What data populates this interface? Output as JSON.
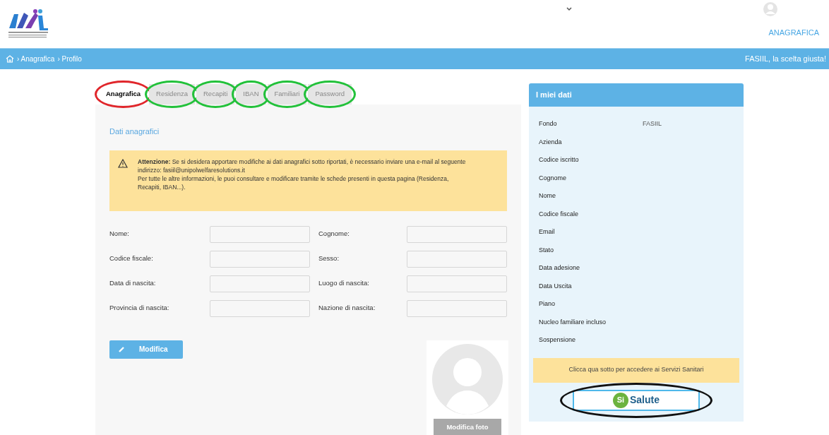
{
  "header": {
    "nav_link": "ANAGRAFICA"
  },
  "breadcrumb": {
    "items": [
      "› Anagrafica",
      "› Profilo"
    ],
    "slogan": "FASIIL, la scelta giusta!"
  },
  "tabs": [
    {
      "label": "Anagrafica",
      "selected": true,
      "color": "#e0262b"
    },
    {
      "label": "Residenza",
      "selected": false,
      "color": "#22c13a"
    },
    {
      "label": "Recapiti",
      "selected": false,
      "color": "#22c13a"
    },
    {
      "label": "IBAN",
      "selected": false,
      "color": "#22c13a"
    },
    {
      "label": "Familiari",
      "selected": false,
      "color": "#22c13a"
    },
    {
      "label": "Password",
      "selected": false,
      "color": "#22c13a"
    }
  ],
  "section_title": "Dati anagrafici",
  "warning": {
    "text": "**Attenzione:** Se si desidera apportare modifiche ai dati anagrafici sotto riportati, è necessario inviare una e-mail al seguente indirizzo: fasiil@unipolwelfaresolutions.it",
    "text2": "Per tutte le altre informazioni, le puoi consultare e modificare tramite le schede presenti in questa pagina (Residenza, Recapiti, IBAN...)."
  },
  "fields": [
    {
      "label": "Nome:"
    },
    {
      "label": "Cognome:"
    },
    {
      "label": "Codice fiscale:"
    },
    {
      "label": "Sesso:"
    },
    {
      "label": "Data di nascita:"
    },
    {
      "label": "Luogo di nascita:"
    },
    {
      "label": "Provincia di nascita:"
    },
    {
      "label": "Nazione di nascita:"
    }
  ],
  "edit_button": "Modifica",
  "photo_button": "Modifica foto",
  "my_data": {
    "title": "I miei dati",
    "rows": [
      {
        "label": "Fondo",
        "value": "FASIIL"
      },
      {
        "label": "Azienda"
      },
      {
        "label": "Codice iscritto"
      },
      {
        "label": "Cognome"
      },
      {
        "label": "Nome"
      },
      {
        "label": "Codice fiscale"
      },
      {
        "label": "Email"
      },
      {
        "label": "Stato"
      },
      {
        "label": "Data adesione"
      },
      {
        "label": "Data Uscita"
      },
      {
        "label": "Piano"
      },
      {
        "label": "Nucleo familiare incluso"
      },
      {
        "label": "Sospensione"
      }
    ],
    "notice": "Clicca qua sotto per accedere ai Servizi Sanitari",
    "service_button": {
      "badge": "Si",
      "label": "Salute",
      "color": "#111111"
    }
  }
}
